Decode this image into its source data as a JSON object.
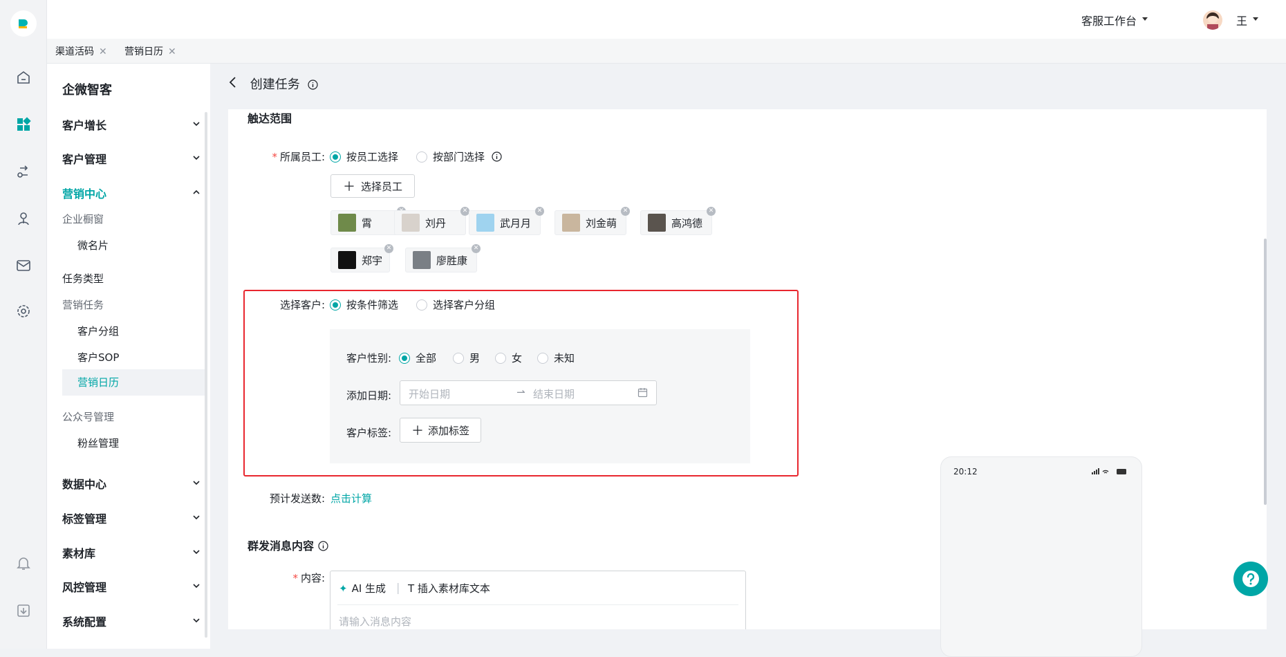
{
  "colors": {
    "accent": "#00a6a6",
    "highlight": "#e8262e",
    "required": "#f54a45"
  },
  "topbar": {
    "workspace": "客服工作台",
    "user": "王"
  },
  "tabs": [
    {
      "label": "渠道活码"
    },
    {
      "label": "营销日历"
    }
  ],
  "sidebar": {
    "brand": "企微智客",
    "menus": [
      "客户增长",
      "客户管理",
      "营销中心",
      "数据中心",
      "标签管理",
      "素材库",
      "风控管理",
      "系统配置"
    ],
    "groups": [
      "企业橱窗",
      "任务类型",
      "营销任务",
      "公众号管理"
    ],
    "subs": [
      "微名片",
      "客户分组",
      "客户SOP",
      "营销日历",
      "粉丝管理"
    ]
  },
  "page": {
    "title": "创建任务"
  },
  "form": {
    "section_reach": "触达范围",
    "staff_label": "所属员工:",
    "staff_opt1": "按员工选择",
    "staff_opt2": "按部门选择",
    "select_staff_btn": "选择员工",
    "staff": [
      "霄",
      "刘丹",
      "武月月",
      "刘金萌",
      "高鸿德",
      "郑宇",
      "廖胜康"
    ],
    "customer_label": "选择客户:",
    "cust_opt1": "按条件筛选",
    "cust_opt2": "选择客户分组",
    "gender_label": "客户性别:",
    "genders": [
      "全部",
      "男",
      "女",
      "未知"
    ],
    "date_label": "添加日期:",
    "date_start": "开始日期",
    "date_end": "结束日期",
    "tag_label": "客户标签:",
    "add_tag_btn": "添加标签",
    "estimate_label": "预计发送数:",
    "estimate_link": "点击计算",
    "section_msg": "群发消息内容",
    "content_label": "内容:",
    "ai_btn": "AI 生成",
    "insert_btn": "T 插入素材库文本",
    "content_placeholder": "请输入消息内容"
  },
  "phone": {
    "time": "20:12"
  }
}
